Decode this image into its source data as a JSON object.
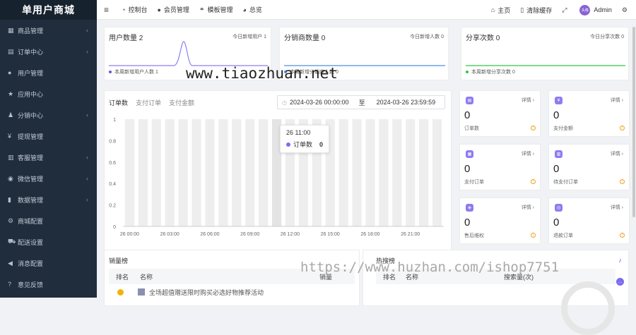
{
  "sidebar": {
    "brand": "单用户商城",
    "items": [
      {
        "label": "商品管理",
        "icon": "grid-icon",
        "glyph": "▦",
        "chevron": true
      },
      {
        "label": "订单中心",
        "icon": "document-icon",
        "glyph": "▤",
        "chevron": true
      },
      {
        "label": "用户管理",
        "icon": "user-icon",
        "glyph": "●",
        "chevron": false
      },
      {
        "label": "应用中心",
        "icon": "star-icon",
        "glyph": "★",
        "chevron": false
      },
      {
        "label": "分销中心",
        "icon": "users-icon",
        "glyph": "♟",
        "chevron": true
      },
      {
        "label": "提现管理",
        "icon": "yen-icon",
        "glyph": "¥",
        "chevron": false
      },
      {
        "label": "客服管理",
        "icon": "table-icon",
        "glyph": "▥",
        "chevron": true
      },
      {
        "label": "微信管理",
        "icon": "wechat-icon",
        "glyph": "◉",
        "chevron": true
      },
      {
        "label": "数据管理",
        "icon": "bar-chart-icon",
        "glyph": "▮",
        "chevron": true
      },
      {
        "label": "商城配置",
        "icon": "gears-icon",
        "glyph": "⚙",
        "chevron": false
      },
      {
        "label": "配送设置",
        "icon": "truck-icon",
        "glyph": "⛟",
        "chevron": false
      },
      {
        "label": "消息配置",
        "icon": "megaphone-icon",
        "glyph": "◀",
        "chevron": false
      },
      {
        "label": "意见反馈",
        "icon": "question-icon",
        "glyph": "?",
        "chevron": false
      }
    ]
  },
  "topbar": {
    "menu_glyph": "≡",
    "nav": [
      {
        "label": "控制台",
        "glyph": "◔"
      },
      {
        "label": "会员管理",
        "glyph": "●"
      },
      {
        "label": "模板管理",
        "glyph": "⚭"
      },
      {
        "label": "总览",
        "glyph": "◕"
      }
    ],
    "right": {
      "home": "主页",
      "clear_cache": "清除缓存",
      "user": "Admin",
      "avatar_text": "头像"
    }
  },
  "stats": [
    {
      "title": "用户数量 2",
      "right": "今日新增用户 1",
      "bottom": "本周新增用户人数 1",
      "color": "#6a5acd"
    },
    {
      "title": "分销商数量 0",
      "right": "今日新增人数 0",
      "bottom": "本周新增分销商人数 0",
      "color": "#4a90e2"
    },
    {
      "title": "分享次数 0",
      "right": "今日分享次数 0",
      "bottom": "本周新增分享次数 0",
      "color": "#2ecc40"
    }
  ],
  "orders": {
    "tabs": [
      "订单数",
      "支付订单",
      "支付金额"
    ],
    "date_start": "2024-03-26 00:00:00",
    "date_sep": "至",
    "date_end": "2024-03-26 23:59:59",
    "tooltip_title": "26 11:00",
    "tooltip_series": "订单数",
    "tooltip_value": "0"
  },
  "chart_data": {
    "type": "bar",
    "categories": [
      "26 00:00",
      "26 01:00",
      "26 02:00",
      "26 03:00",
      "26 04:00",
      "26 05:00",
      "26 06:00",
      "26 07:00",
      "26 08:00",
      "26 09:00",
      "26 10:00",
      "26 11:00",
      "26 12:00",
      "26 13:00",
      "26 14:00",
      "26 15:00",
      "26 16:00",
      "26 17:00",
      "26 18:00",
      "26 19:00",
      "26 20:00",
      "26 21:00",
      "26 22:00",
      "26 23:00"
    ],
    "xticks": [
      "26 00:00",
      "26 03:00",
      "26 06:00",
      "26 09:00",
      "26 12:00",
      "26 15:00",
      "26 18:00",
      "26 21:00"
    ],
    "xtick_index": [
      0,
      3,
      6,
      9,
      12,
      15,
      18,
      21
    ],
    "series": [
      {
        "name": "订单数",
        "values": [
          0,
          0,
          0,
          0,
          0,
          0,
          0,
          0,
          0,
          0,
          0,
          0,
          0,
          0,
          0,
          0,
          0,
          0,
          0,
          0,
          0,
          0,
          0,
          0
        ]
      }
    ],
    "ylim": [
      0,
      1
    ],
    "yticks": [
      "1",
      "0.8",
      "0.6",
      "0.4",
      "0.2",
      "0"
    ],
    "highlight_index": 11
  },
  "mini_cards": [
    {
      "value": "0",
      "label": "订单数",
      "detail": "详情 ›",
      "glyph": "▤"
    },
    {
      "value": "0",
      "label": "支付金额",
      "detail": "详情 ›",
      "glyph": "¥"
    },
    {
      "value": "0",
      "label": "支付订单",
      "detail": "详情 ›",
      "glyph": "▦"
    },
    {
      "value": "0",
      "label": "待支付订单",
      "detail": "详情 ›",
      "glyph": "▥"
    },
    {
      "value": "0",
      "label": "售后维权",
      "detail": "详情 ›",
      "glyph": "◈"
    },
    {
      "value": "0",
      "label": "退款订单",
      "detail": "详情 ›",
      "glyph": "◎"
    }
  ],
  "sales": {
    "title": "销量榜",
    "cols": [
      "排名",
      "名称",
      "销量"
    ],
    "row_text": "全场超值赠送限时购买必选好物推荐活动"
  },
  "hot": {
    "title": "热搜榜",
    "cols": [
      "排名",
      "名称",
      "搜索量(次)"
    ]
  },
  "watermarks": {
    "mid": "www.tiaozhuan.net",
    "bottom": "https://www.huzhan.com/ishop7751"
  },
  "colors": {
    "sidebar": "#1f2d3d",
    "accent": "#7b6cf0",
    "line_user": "#8a7ff0",
    "line_dist": "#4a90e2",
    "line_share": "#2ecc40"
  }
}
